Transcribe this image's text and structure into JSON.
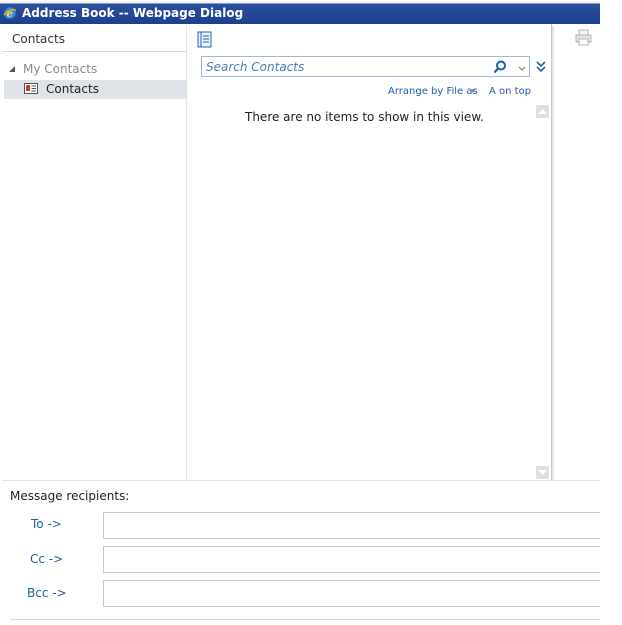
{
  "window": {
    "title": "Address Book -- Webpage Dialog"
  },
  "nav": {
    "header": "Contacts",
    "tree_root": "My Contacts",
    "tree_items": [
      {
        "label": "Contacts",
        "selected": true
      }
    ]
  },
  "search": {
    "placeholder": "Search Contacts",
    "value": ""
  },
  "list": {
    "arrange_label": "Arrange by File as",
    "order_label": "A on top",
    "empty_message": "There are no items to show in this view."
  },
  "recipients": {
    "label": "Message recipients:",
    "to_label": "To ->",
    "cc_label": "Cc ->",
    "bcc_label": "Bcc ->",
    "to_value": "",
    "cc_value": "",
    "bcc_value": ""
  },
  "icons": {
    "browser": "ie-icon",
    "address_book": "book-icon",
    "search": "search-icon",
    "expand": "double-chevron-down-icon",
    "print": "print-icon",
    "contact_card": "contact-card-icon"
  },
  "colors": {
    "accent": "#1f5fa6",
    "titlebar": "#1c3f8f",
    "selection": "#dfe3e8",
    "search_border": "#9fb9d2"
  }
}
